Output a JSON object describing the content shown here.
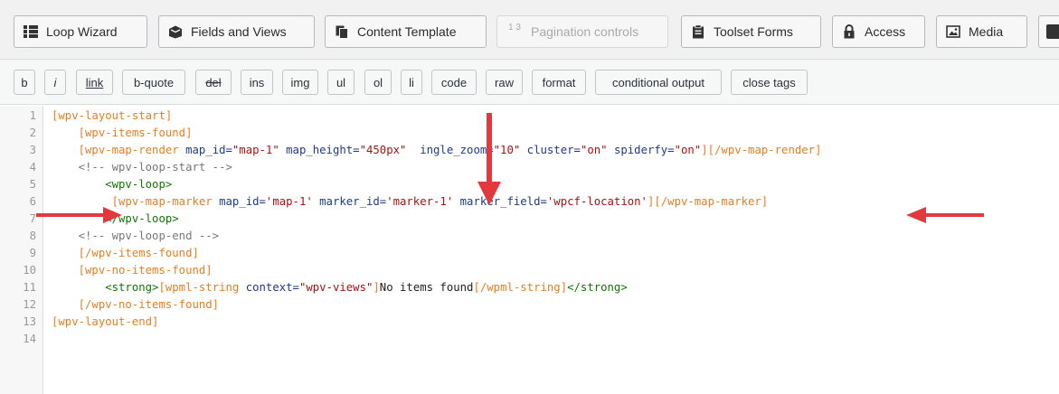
{
  "toolbar": {
    "buttons": [
      {
        "label": "Loop Wizard",
        "icon": "grid-icon",
        "disabled": false
      },
      {
        "label": "Fields and Views",
        "icon": "box-icon",
        "disabled": false
      },
      {
        "label": "Content Template",
        "icon": "copy-icon",
        "disabled": false
      },
      {
        "label": "Pagination controls",
        "icon": "pagination-icon",
        "icon_text": "1 3",
        "disabled": true
      },
      {
        "label": "Toolset Forms",
        "icon": "clipboard-icon",
        "disabled": false
      },
      {
        "label": "Access",
        "icon": "lock-icon",
        "disabled": false
      },
      {
        "label": "Media",
        "icon": "image-icon",
        "disabled": false
      }
    ]
  },
  "quicktags": [
    "b",
    "i",
    "link",
    "b-quote",
    "del",
    "ins",
    "img",
    "ul",
    "ol",
    "li",
    "code",
    "raw",
    "format",
    "conditional output",
    "close tags"
  ],
  "editor": {
    "lines": [
      [
        {
          "t": "[wpv-layout-start]",
          "c": "sc"
        }
      ],
      [
        {
          "t": "    [wpv-items-found]",
          "c": "sc"
        }
      ],
      [
        {
          "t": "    [wpv-map-render ",
          "c": "sc"
        },
        {
          "t": "map_id=",
          "c": "at"
        },
        {
          "t": "\"map-1\"",
          "c": "st"
        },
        {
          "t": " map_height=",
          "c": "at"
        },
        {
          "t": "\"450px\"",
          "c": "st"
        },
        {
          "t": "  ",
          "c": "tx"
        },
        {
          "t": "ingle_zoom=",
          "c": "at"
        },
        {
          "t": "\"10\"",
          "c": "st"
        },
        {
          "t": " cluster=",
          "c": "at"
        },
        {
          "t": "\"on\"",
          "c": "st"
        },
        {
          "t": " spiderfy=",
          "c": "at"
        },
        {
          "t": "\"on\"",
          "c": "st"
        },
        {
          "t": "][/wpv-map-render]",
          "c": "sc"
        }
      ],
      [
        {
          "t": "    <!-- wpv-loop-start -->",
          "c": "cm"
        }
      ],
      [
        {
          "t": "        <wpv-loop>",
          "c": "tg"
        }
      ],
      [
        {
          "t": "         [wpv-map-marker ",
          "c": "sc"
        },
        {
          "t": "map_id=",
          "c": "at"
        },
        {
          "t": "'map-1'",
          "c": "st"
        },
        {
          "t": " marker_id=",
          "c": "at"
        },
        {
          "t": "'marker-1'",
          "c": "st"
        },
        {
          "t": " marker_field=",
          "c": "at"
        },
        {
          "t": "'wpcf-location'",
          "c": "st"
        },
        {
          "t": "][/wpv-map-marker]",
          "c": "sc"
        }
      ],
      [
        {
          "t": "        </wpv-loop>",
          "c": "tg"
        }
      ],
      [
        {
          "t": "    <!-- wpv-loop-end -->",
          "c": "cm"
        }
      ],
      [
        {
          "t": "    [/wpv-items-found]",
          "c": "sc"
        }
      ],
      [
        {
          "t": "    [wpv-no-items-found]",
          "c": "sc"
        }
      ],
      [
        {
          "t": "        <strong>",
          "c": "tg"
        },
        {
          "t": "[wpml-string ",
          "c": "sc"
        },
        {
          "t": "context=",
          "c": "at"
        },
        {
          "t": "\"wpv-views\"",
          "c": "st"
        },
        {
          "t": "]",
          "c": "sc"
        },
        {
          "t": "No items found",
          "c": "tx"
        },
        {
          "t": "[/wpml-string]",
          "c": "sc"
        },
        {
          "t": "</strong>",
          "c": "tg"
        }
      ],
      [
        {
          "t": "    [/wpv-no-items-found]",
          "c": "sc"
        }
      ],
      [
        {
          "t": "[wpv-layout-end]",
          "c": "sc"
        }
      ],
      [
        {
          "t": "",
          "c": "tx"
        }
      ]
    ],
    "line_numbers": [
      "1",
      "2",
      "3",
      "4",
      "5",
      "6",
      "7",
      "8",
      "9",
      "10",
      "11",
      "12",
      "13",
      "14"
    ]
  },
  "colors": {
    "shortcode": "#e67e22",
    "attribute": "#1e3a8a",
    "string": "#aa1111",
    "comment": "#777777",
    "tag": "#117700",
    "arrow": "#e0393e"
  }
}
